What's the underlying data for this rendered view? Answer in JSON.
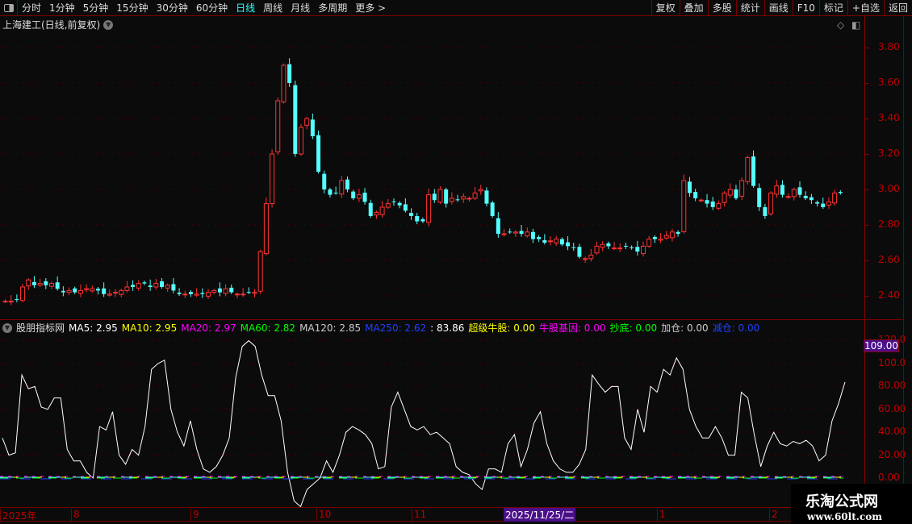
{
  "toolbar": {
    "periods": [
      "分时",
      "1分钟",
      "5分钟",
      "15分钟",
      "30分钟",
      "60分钟",
      "日线",
      "周线",
      "月线",
      "多周期",
      "更多 >"
    ],
    "active": "日线",
    "right": [
      "复权",
      "叠加",
      "多股",
      "统计",
      "画线",
      "F10",
      "标记",
      "+自选",
      "返回"
    ]
  },
  "chart": {
    "title": "上海建工(日线,前复权)",
    "yticks": [
      "3.80",
      "3.60",
      "3.40",
      "3.20",
      "3.00",
      "2.80",
      "2.60",
      "2.40"
    ],
    "closes": [
      2.37,
      2.37,
      2.38,
      2.45,
      2.49,
      2.46,
      2.47,
      2.46,
      2.47,
      2.44,
      2.42,
      2.43,
      2.42,
      2.43,
      2.44,
      2.44,
      2.43,
      2.41,
      2.41,
      2.42,
      2.43,
      2.45,
      2.45,
      2.47,
      2.47,
      2.45,
      2.47,
      2.45,
      2.46,
      2.43,
      2.41,
      2.41,
      2.41,
      2.41,
      2.41,
      2.42,
      2.43,
      2.42,
      2.44,
      2.42,
      2.41,
      2.41,
      2.42,
      2.42,
      2.65,
      2.92,
      3.2,
      3.5,
      3.7,
      3.6,
      3.2,
      3.35,
      3.4,
      3.3,
      3.1,
      3.0,
      2.97,
      2.98,
      3.05,
      3.0,
      2.95,
      2.97,
      2.93,
      2.85,
      2.87,
      2.9,
      2.92,
      2.93,
      2.91,
      2.88,
      2.85,
      2.82,
      2.82,
      2.97,
      2.94,
      3.0,
      2.92,
      2.95,
      2.94,
      2.96,
      2.95,
      2.98,
      3.0,
      2.92,
      2.85,
      2.75,
      2.75,
      2.76,
      2.76,
      2.75,
      2.76,
      2.72,
      2.72,
      2.7,
      2.71,
      2.72,
      2.69,
      2.68,
      2.67,
      2.62,
      2.61,
      2.63,
      2.68,
      2.69,
      2.68,
      2.67,
      2.67,
      2.68,
      2.67,
      2.65,
      2.68,
      2.72,
      2.72,
      2.72,
      2.74,
      2.76,
      2.75,
      3.05,
      2.98,
      2.95,
      2.94,
      2.92,
      2.9,
      2.92,
      2.98,
      3.0,
      2.95,
      3.05,
      3.18,
      3.02,
      2.9,
      2.85,
      2.98,
      3.02,
      2.97,
      2.96,
      3.0,
      2.97,
      2.95,
      2.94,
      2.92,
      2.9,
      2.93,
      2.98,
      2.98
    ],
    "ytop": 3.8,
    "ybottom": 2.4
  },
  "indicator": {
    "name": "股朋指标网",
    "legend": [
      {
        "label": "MA5: 2.95",
        "color": "#ffffff"
      },
      {
        "label": "MA10: 2.95",
        "color": "#ffff00"
      },
      {
        "label": "MA20: 2.97",
        "color": "#ff00ff"
      },
      {
        "label": "MA60: 2.82",
        "color": "#00ff00"
      },
      {
        "label": "MA120: 2.85",
        "color": "#cccccc"
      },
      {
        "label": "MA250: 2.62",
        "color": "#2040ff"
      },
      {
        "label": ": 83.86",
        "color": "#ffffff"
      },
      {
        "label": "超级牛股: 0.00",
        "color": "#ffff00"
      },
      {
        "label": "牛股基因: 0.00",
        "color": "#ff00ff"
      },
      {
        "label": "抄底: 0.00",
        "color": "#00ff00"
      },
      {
        "label": "加仓: 0.00",
        "color": "#cccccc"
      },
      {
        "label": "减仓: 0.00",
        "color": "#2040ff"
      }
    ],
    "yticks": [
      "120.0",
      "100.0",
      "80.00",
      "60.00",
      "40.00",
      "20.00",
      "0.00"
    ],
    "current": "109.00",
    "values": [
      35,
      20,
      22,
      90,
      78,
      80,
      62,
      60,
      70,
      70,
      25,
      15,
      15,
      5,
      0,
      45,
      42,
      58,
      20,
      12,
      25,
      20,
      45,
      95,
      100,
      103,
      60,
      40,
      28,
      50,
      25,
      8,
      5,
      10,
      20,
      35,
      88,
      115,
      120,
      115,
      90,
      72,
      72,
      50,
      5,
      -20,
      -25,
      -10,
      -5,
      0,
      15,
      5,
      20,
      40,
      45,
      42,
      38,
      30,
      8,
      10,
      62,
      75,
      60,
      45,
      42,
      45,
      38,
      40,
      35,
      30,
      10,
      5,
      3,
      -5,
      -10,
      8,
      8,
      5,
      30,
      38,
      10,
      25,
      48,
      58,
      30,
      15,
      8,
      5,
      5,
      12,
      25,
      90,
      82,
      75,
      80,
      80,
      35,
      25,
      60,
      40,
      80,
      75,
      95,
      90,
      105,
      95,
      60,
      45,
      35,
      35,
      45,
      35,
      20,
      20,
      75,
      70,
      38,
      10,
      28,
      40,
      30,
      28,
      32,
      30,
      33,
      28,
      15,
      20,
      50,
      65,
      83.86
    ]
  },
  "timeaxis": {
    "labels": [
      "2025年",
      "8",
      "9",
      "10",
      "11",
      "1",
      "2"
    ],
    "cursor": "2025/11/25/二"
  },
  "watermark": {
    "line1": "乐淘公式网",
    "line2": "www.60lt.com"
  }
}
